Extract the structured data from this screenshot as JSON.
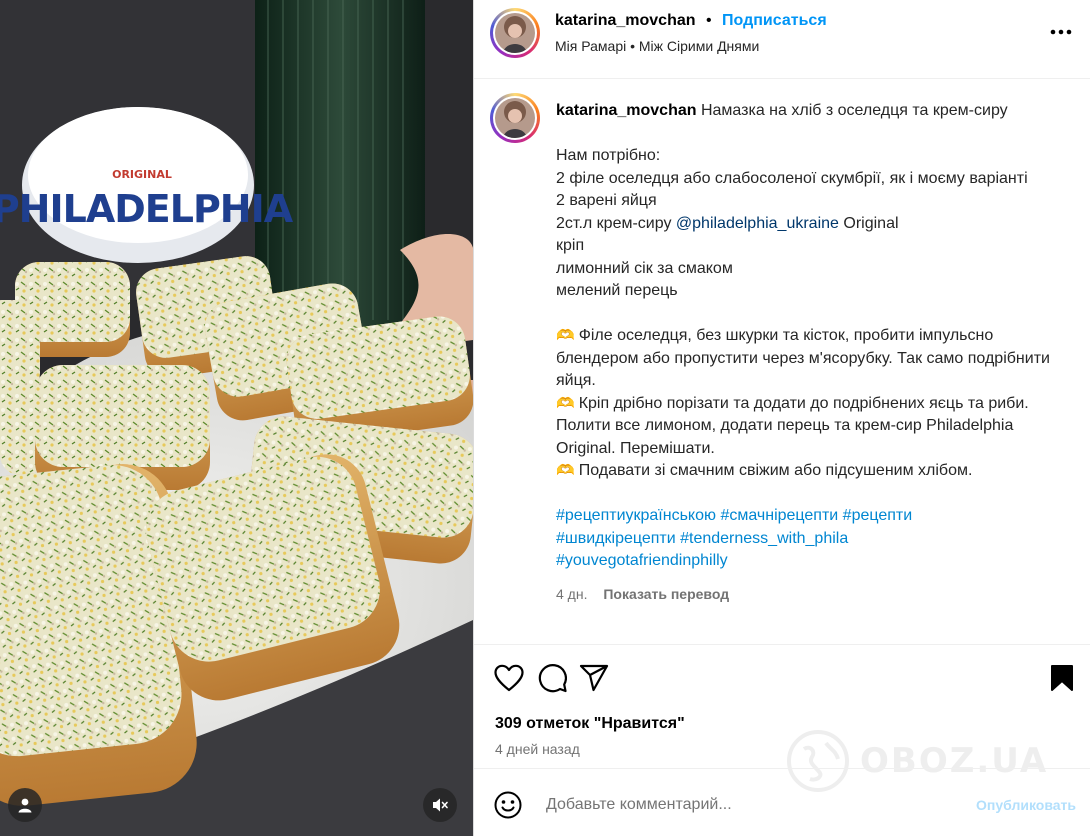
{
  "header": {
    "username": "katarina_movchan",
    "separator": "•",
    "follow_label": "Подписаться",
    "music": "Мія Рамарі • Між Сірими Днями"
  },
  "media": {
    "tub_brand": "PHILADELPHIA",
    "tub_original": "ORIGINAL"
  },
  "caption": {
    "username": "katarina_movchan",
    "title": "Намазка на хліб з оселедця та крем-сиру",
    "need": "Нам потрібно:",
    "ingredient_1": "2 філе оселедця або слабосоленої скумбрії, як і моєму варіанті",
    "ingredient_2": "2 варені яйця",
    "ingredient_3_prefix": "2ст.л крем-сиру ",
    "ingredient_3_mention": "@philadelphia_ukraine",
    "ingredient_3_suffix": " Original",
    "ingredient_4": "кріп",
    "ingredient_5": "лимонний сік за смаком",
    "ingredient_6": "мелений перець",
    "step_icon": "🫶",
    "step_1": "Філе оселедця, без шкурки та кісток, пробити імпульсно блендером або пропустити через м'ясорубку. Так само подрібнити яйця.",
    "step_2": "Кріп дрібно порізати та додати до подрібнених яєць та риби. Полити все лимоном, додати перець та крем-сир Philadelphia Original. Перемішати.",
    "step_3": "Подавати зі смачним свіжим або підсушеним хлібом.",
    "hashtags_line_1": "#рецептиукраїнською #смачнірецепти #рецепти",
    "hashtags_line_2": "#швидкірецепти #tenderness_with_phila",
    "hashtags_line_3": "#youvegotafriendinphilly",
    "time": "4 дн.",
    "translate_label": "Показать перевод"
  },
  "actions": {
    "likes": "309 отметок \"Нравится\"",
    "ago": "4 дней назад"
  },
  "watermark": {
    "text": "OBOZ.UA"
  },
  "comment": {
    "placeholder": "Добавьте комментарий...",
    "publish_label": "Опубликовать"
  },
  "colors": {
    "accent_blue": "#0095f6",
    "hashtag_blue": "#0086d1",
    "mention_blue": "#00376b",
    "muted_gray": "#737373",
    "publish_disabled": "#b2dffc"
  },
  "icons": [
    "heart-icon",
    "comment-icon",
    "share-icon",
    "bookmark-icon",
    "more-icon",
    "emoji-icon",
    "mute-icon",
    "user-tag-icon"
  ]
}
